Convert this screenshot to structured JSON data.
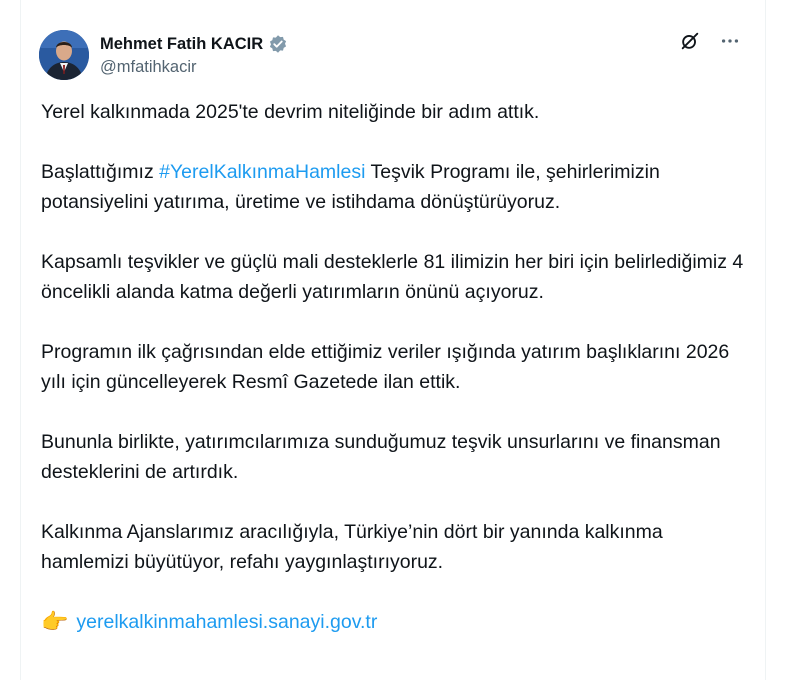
{
  "author": {
    "name": "Mehmet Fatih KACIR",
    "handle": "@mfatihkacir",
    "verified": true,
    "verified_color": "#536471"
  },
  "actions": {
    "grok_icon": "slash-circle-icon",
    "more_icon": "more-dots-icon"
  },
  "post": {
    "p1": "Yerel kalkınmada 2025'te devrim niteliğinde bir adım attık.",
    "p2_before": "Başlattığımız ",
    "p2_hashtag": "#YerelKalkınmaHamlesi",
    "p2_after": " Teşvik Programı ile, şehirlerimizin potansiyelini yatırıma, üretime ve istihdama dönüştürüyoruz.",
    "p3": "Kapsamlı teşvikler ve güçlü mali desteklerle 81 ilimizin her biri için belirlediğimiz 4 öncelikli alanda katma değerli yatırımların önünü açıyoruz.",
    "p4": "Programın ilk çağrısından elde ettiğimiz veriler ışığında yatırım başlıklarını 2026 yılı için güncelleyerek Resmî Gazetede ilan ettik.",
    "p5": "Bununla birlikte, yatırımcılarımıza sunduğumuz teşvik unsurlarını ve finansman desteklerini de artırdık.",
    "p6": "Kalkınma Ajanslarımız aracılığıyla, Türkiye’nin dört bir yanında kalkınma hamlemizi büyütüyor, refahı yaygınlaştırıyoruz.",
    "link_emoji": "👉",
    "link_text": "yerelkalkinmahamlesi.sanayi.gov.tr"
  },
  "colors": {
    "link": "#1d9bf0",
    "text": "#0f1419",
    "muted": "#536471"
  }
}
